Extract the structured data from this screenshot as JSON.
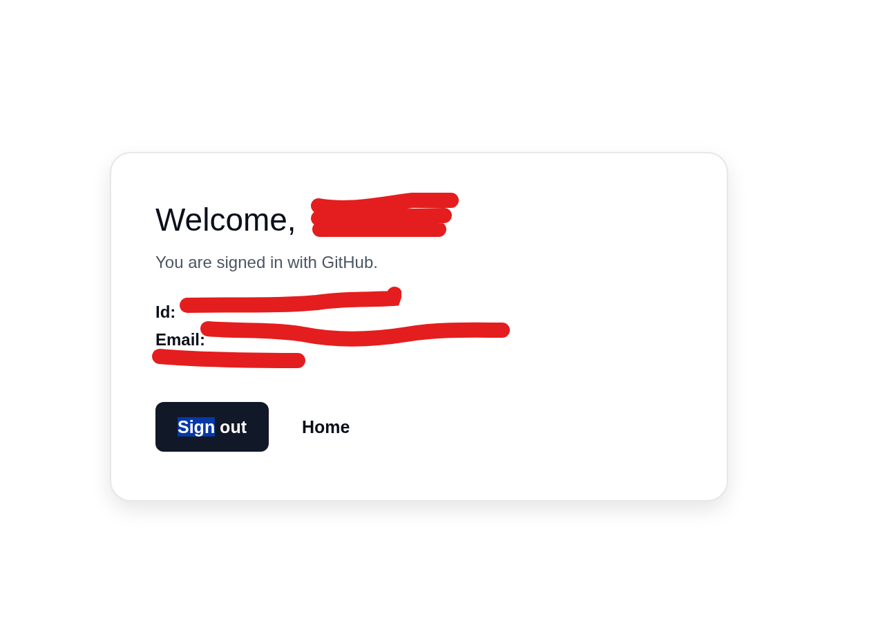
{
  "card": {
    "title": "Welcome,",
    "title_redacted": true,
    "subtitle": "You are signed in with GitHub.",
    "fields": [
      {
        "label": "Id:",
        "redacted": true
      },
      {
        "label": "Email:",
        "redacted": true
      },
      {
        "redacted": true
      }
    ],
    "buttons": [
      {
        "kind": "primary",
        "label_parts": [
          {
            "text": "Sign",
            "highlighted": true
          },
          {
            "text": " out",
            "highlighted": false
          }
        ]
      },
      {
        "kind": "link",
        "label_parts": [
          {
            "text": "Home",
            "highlighted": false
          }
        ]
      }
    ]
  }
}
